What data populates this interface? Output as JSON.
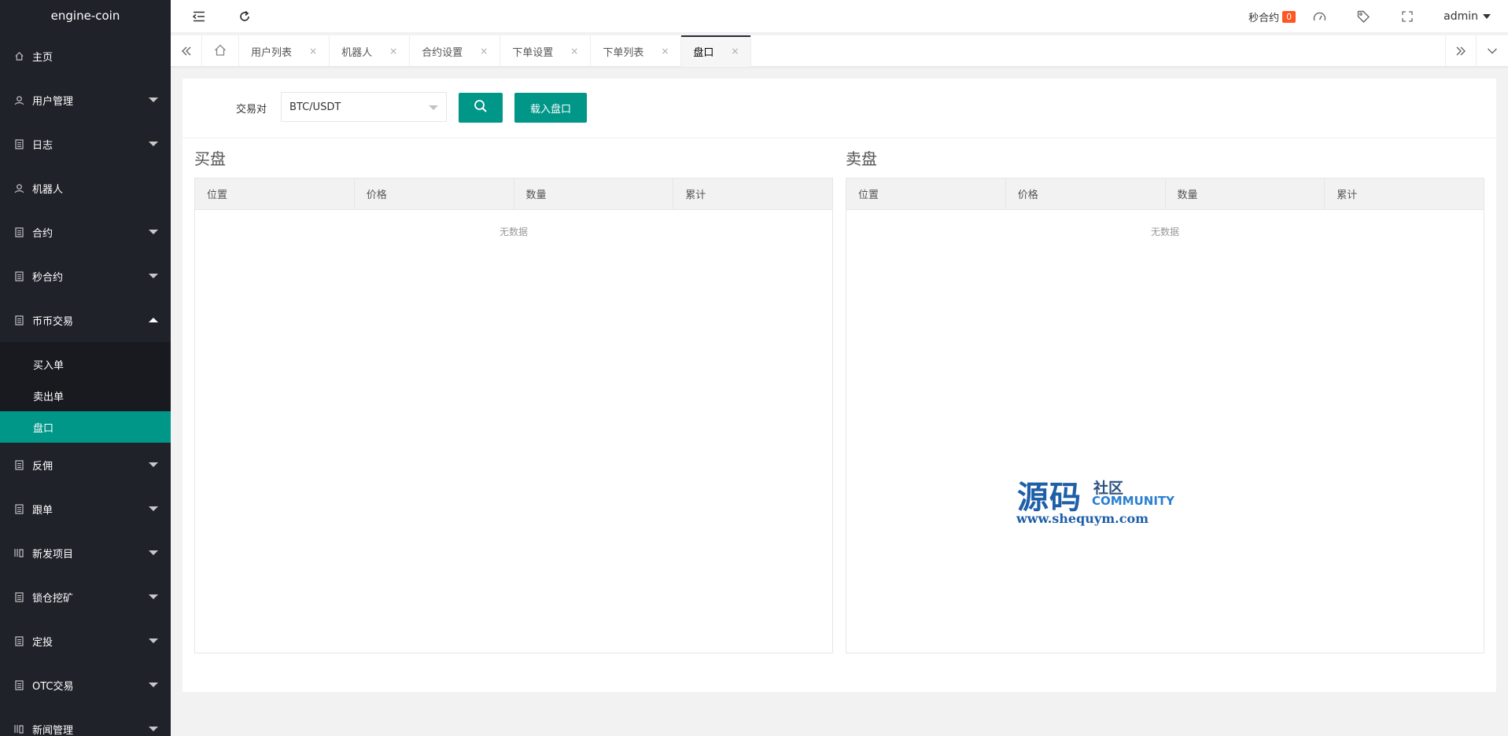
{
  "app": {
    "title": "engine-coin"
  },
  "sidebar": {
    "items": [
      {
        "label": "主页",
        "icon": "home-icon",
        "caret": "none"
      },
      {
        "label": "用户管理",
        "icon": "user-icon",
        "caret": "down"
      },
      {
        "label": "日志",
        "icon": "doc-icon",
        "caret": "down"
      },
      {
        "label": "机器人",
        "icon": "user-icon",
        "caret": "none"
      },
      {
        "label": "合约",
        "icon": "doc-icon",
        "caret": "down"
      },
      {
        "label": "秒合约",
        "icon": "doc-icon",
        "caret": "down"
      },
      {
        "label": "币币交易",
        "icon": "doc-icon",
        "caret": "up"
      }
    ],
    "subitems": [
      {
        "label": "买入单",
        "active": false
      },
      {
        "label": "卖出单",
        "active": false
      },
      {
        "label": "盘口",
        "active": true
      }
    ],
    "items_after": [
      {
        "label": "反佣",
        "icon": "doc-icon"
      },
      {
        "label": "跟单",
        "icon": "doc-icon"
      },
      {
        "label": "新发项目",
        "icon": "grid-icon"
      },
      {
        "label": "锁仓挖矿",
        "icon": "doc-icon"
      },
      {
        "label": "定投",
        "icon": "doc-icon"
      },
      {
        "label": "OTC交易",
        "icon": "doc-icon"
      },
      {
        "label": "新闻管理",
        "icon": "grid-icon"
      }
    ]
  },
  "header": {
    "miao_label": "秒合约",
    "miao_count": "0",
    "user": "admin"
  },
  "tabs": {
    "items": [
      {
        "label": "用户列表"
      },
      {
        "label": "机器人"
      },
      {
        "label": "合约设置"
      },
      {
        "label": "下单设置"
      },
      {
        "label": "下单列表"
      },
      {
        "label": "盘口",
        "active": true
      }
    ],
    "close_glyph": "×"
  },
  "filter": {
    "label": "交易对",
    "selected": "BTC/USDT",
    "load_button": "载入盘口"
  },
  "buy": {
    "title": "买盘",
    "columns": [
      "位置",
      "价格",
      "数量",
      "累计"
    ],
    "empty": "无数据"
  },
  "sell": {
    "title": "卖盘",
    "columns": [
      "位置",
      "价格",
      "数量",
      "累计"
    ],
    "empty": "无数据"
  },
  "watermark": {
    "big": "源码",
    "she": "社区",
    "community": "COMMUNITY",
    "url": "www.shequym.com"
  },
  "colors": {
    "accent": "#009688",
    "sidebar_bg": "#20222a",
    "badge": "#ff5722"
  }
}
